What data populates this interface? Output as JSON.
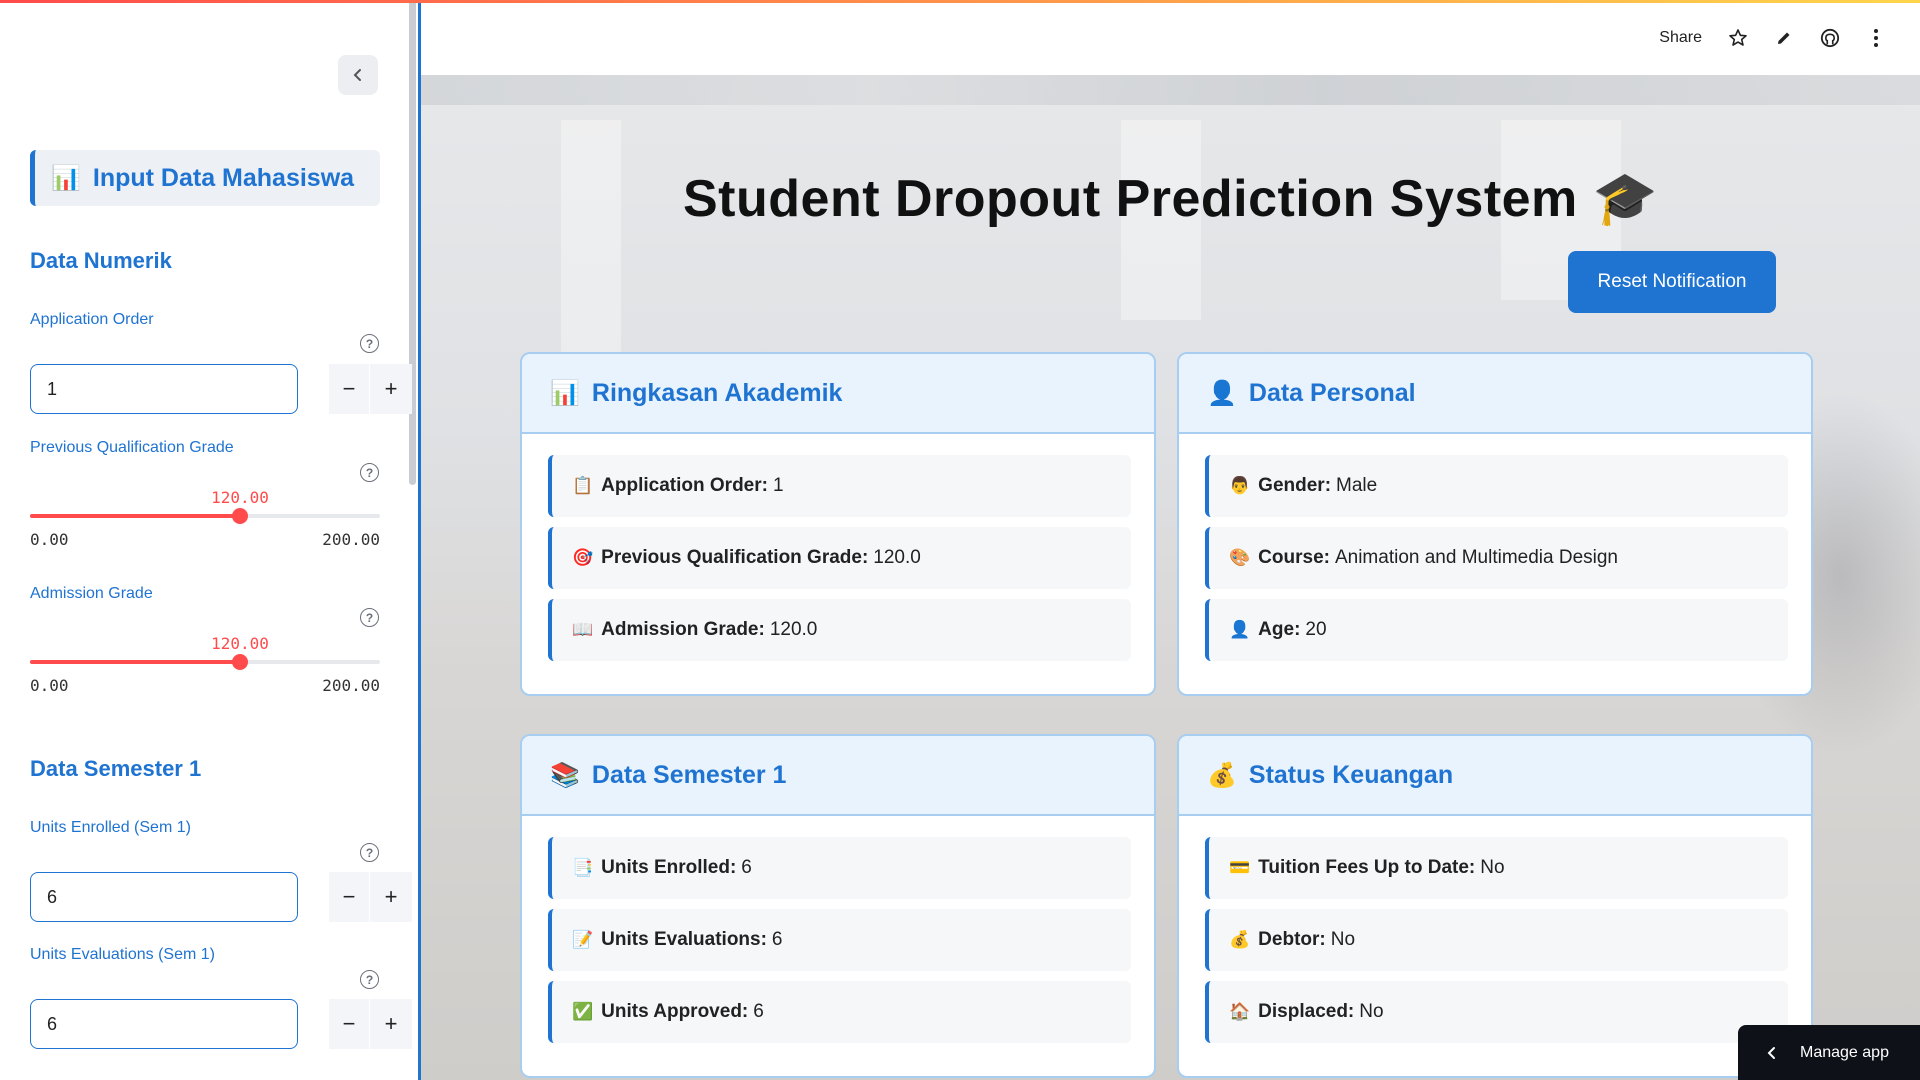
{
  "sidebar": {
    "header": {
      "emoji": "📊",
      "label": "Input Data Mahasiswa"
    },
    "sections": {
      "numerik": "Data Numerik",
      "semester1": "Data Semester 1"
    },
    "fields": {
      "application_order": {
        "label": "Application Order",
        "value": "1"
      },
      "prev_grade": {
        "label": "Previous Qualification Grade",
        "value": "120.00",
        "min": "0.00",
        "max": "200.00",
        "fraction": 0.6
      },
      "admission_grade": {
        "label": "Admission Grade",
        "value": "120.00",
        "min": "0.00",
        "max": "200.00",
        "fraction": 0.6
      },
      "units_enrolled": {
        "label": "Units Enrolled (Sem 1)",
        "value": "6"
      },
      "units_evaluations": {
        "label": "Units Evaluations (Sem 1)",
        "value": "6"
      }
    }
  },
  "header": {
    "share": "Share"
  },
  "main": {
    "title": "Student Dropout Prediction System 🎓",
    "reset_button": "Reset Notification",
    "cards": {
      "akademik": {
        "title_emoji": "📊",
        "title": "Ringkasan Akademik",
        "rows": [
          {
            "emoji": "📋",
            "label": "Application Order:",
            "value": "1"
          },
          {
            "emoji": "🎯",
            "label": "Previous Qualification Grade:",
            "value": "120.0"
          },
          {
            "emoji": "📖",
            "label": "Admission Grade:",
            "value": "120.0"
          }
        ]
      },
      "personal": {
        "title_emoji": "👤",
        "title": "Data Personal",
        "rows": [
          {
            "emoji": "👨",
            "label": "Gender:",
            "value": "Male"
          },
          {
            "emoji": "🎨",
            "label": "Course:",
            "value": "Animation and Multimedia Design"
          },
          {
            "emoji": "👤",
            "label": "Age:",
            "value": "20"
          }
        ]
      },
      "semester1": {
        "title_emoji": "📚",
        "title": "Data Semester 1",
        "rows": [
          {
            "emoji": "📑",
            "label": "Units Enrolled:",
            "value": "6"
          },
          {
            "emoji": "📝",
            "label": "Units Evaluations:",
            "value": "6"
          },
          {
            "emoji": "✅",
            "label": "Units Approved:",
            "value": "6"
          }
        ]
      },
      "keuangan": {
        "title_emoji": "💰",
        "title": "Status Keuangan",
        "rows": [
          {
            "emoji": "💳",
            "label": "Tuition Fees Up to Date:",
            "value": "No"
          },
          {
            "emoji": "💰",
            "label": "Debtor:",
            "value": "No"
          },
          {
            "emoji": "🏠",
            "label": "Displaced:",
            "value": "No"
          }
        ]
      }
    }
  },
  "manage_app": "Manage app"
}
